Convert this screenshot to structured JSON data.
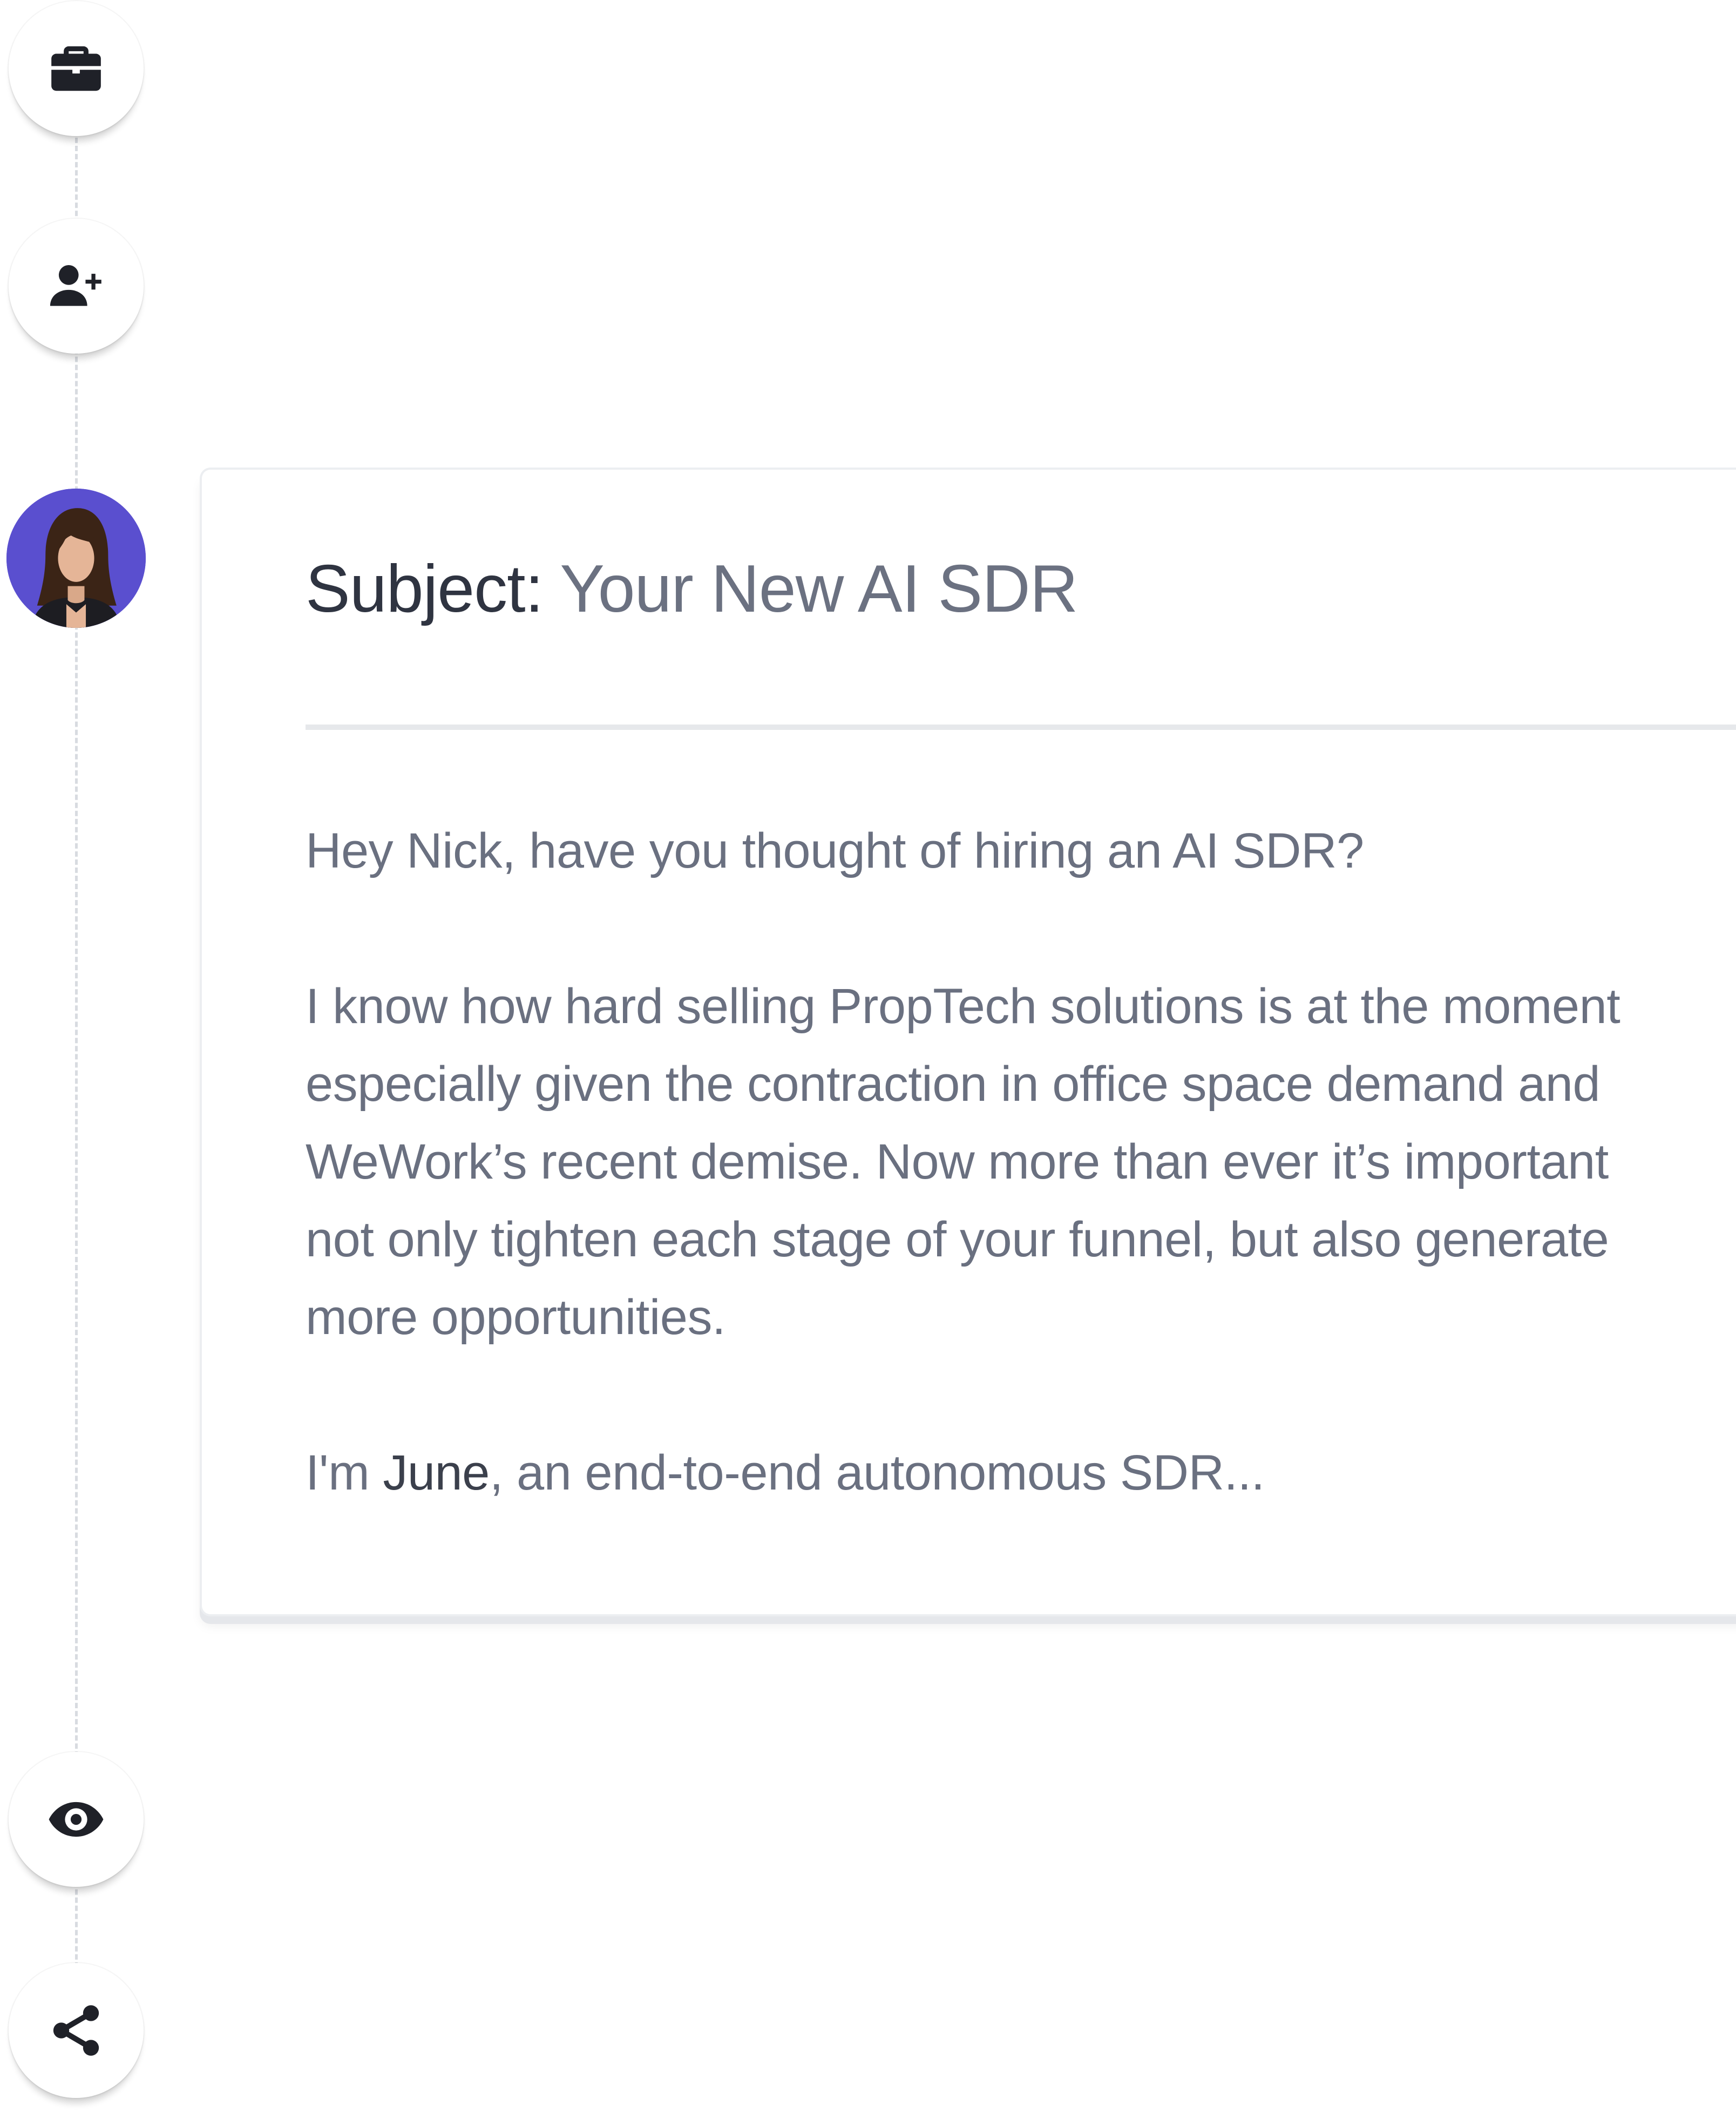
{
  "timeline": {
    "icons": [
      "briefcase-icon",
      "user-add-icon",
      "agent-avatar",
      "eye-icon",
      "share-icon"
    ]
  },
  "email": {
    "subject_label": "Subject:",
    "subject": "Your New AI SDR",
    "greeting": "Hey Nick, have you thought of hiring an AI SDR?",
    "paragraph_lines": [
      "I know how hard selling PropTech solutions is at the moment",
      "especially given the contraction in office space demand and",
      "WeWork’s recent demise. Now more than ever it’s important",
      "not only tighten each stage of your funnel, but also generate",
      "more opportunities."
    ],
    "intro_prefix": "I'm",
    "intro_name": "June",
    "intro_suffix": ", an end-to-end autonomous SDR..."
  },
  "colors": {
    "avatar_bg": "#5a4fcf",
    "icon": "#1f2128",
    "text": "#6a7080",
    "heading": "#2f3441"
  }
}
